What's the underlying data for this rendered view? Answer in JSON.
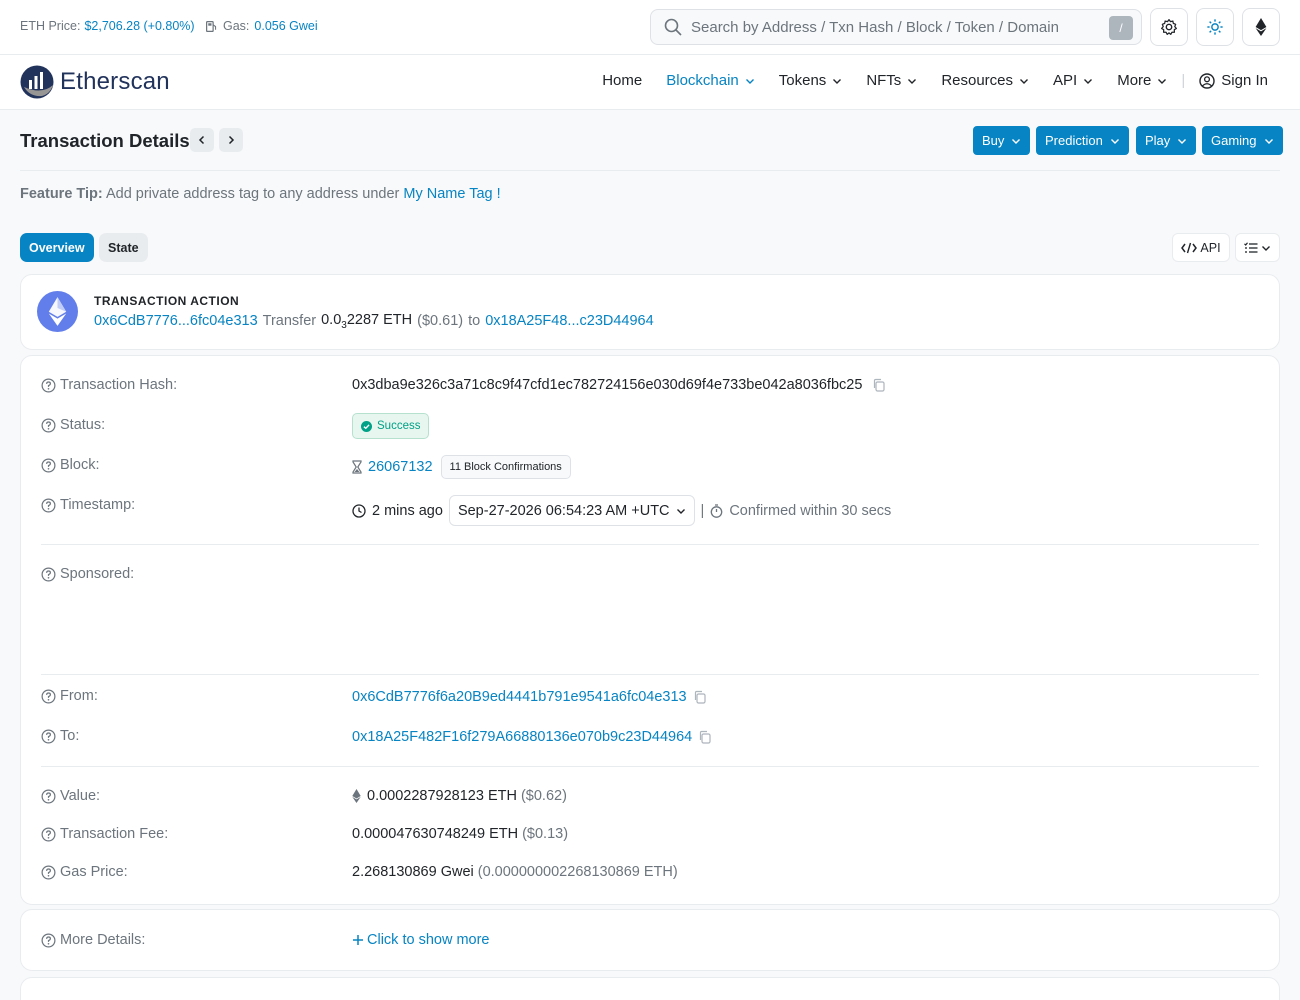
{
  "topbar": {
    "eth_price_label": "ETH Price:",
    "eth_price_value": "$2,706.28 (+0.80%)",
    "gas_label": "Gas:",
    "gas_value": "0.056 Gwei",
    "search_placeholder": "Search by Address / Txn Hash / Block / Token / Domain",
    "search_shortcut": "/"
  },
  "nav": {
    "logo_text": "Etherscan",
    "items": [
      "Home",
      "Blockchain",
      "Tokens",
      "NFTs",
      "Resources",
      "API",
      "More"
    ],
    "separator": "|",
    "sign_in": "Sign In"
  },
  "page": {
    "title": "Transaction Details",
    "buttons": [
      "Buy",
      "Prediction",
      "Play",
      "Gaming"
    ],
    "tip_label": "Feature Tip:",
    "tip_text": "Add private address tag to any address under",
    "tip_link": "My Name Tag !",
    "tabs": [
      "Overview",
      "State"
    ],
    "api_btn": "API"
  },
  "action": {
    "title": "TRANSACTION ACTION",
    "from": "0x6CdB7776...6fc04e313",
    "verb": "Transfer",
    "amount_main": "0.0",
    "amount_sub": "3",
    "amount_rest": "2287 ETH",
    "usd": "($0.61)",
    "to_word": "to",
    "to": "0x18A25F48...c23D44964"
  },
  "details": {
    "hash_label": "Transaction Hash:",
    "hash": "0x3dba9e326c3a71c8c9f47cfd1ec782724156e030d69f4e733be042a8036fbc25",
    "status_label": "Status:",
    "status": "Success",
    "block_label": "Block:",
    "block": "26067132",
    "confirmations": "11 Block Confirmations",
    "timestamp_label": "Timestamp:",
    "time_ago": "2 mins ago",
    "timestamp": "Sep-27-2026 06:54:23 AM +UTC",
    "ts_sep": "|",
    "confirmed": "Confirmed within 30 secs",
    "sponsored_label": "Sponsored:",
    "from_label": "From:",
    "from": "0x6CdB7776f6a20B9ed4441b791e9541a6fc04e313",
    "to_label": "To:",
    "to": "0x18A25F482F16f279A66880136e070b9c23D44964",
    "value_label": "Value:",
    "value": "0.0002287928123 ETH",
    "value_usd": "($0.62)",
    "fee_label": "Transaction Fee:",
    "fee": "0.000047630748249 ETH",
    "fee_usd": "($0.13)",
    "gas_price_label": "Gas Price:",
    "gas_price": "2.268130869 Gwei",
    "gas_price_eth": "(0.000000002268130869 ETH)"
  },
  "more": {
    "label": "More Details:",
    "link": "Click to show more"
  },
  "colors": {
    "accent": "#0784c3",
    "success": "#00a186",
    "brand_dark": "#21325b"
  }
}
